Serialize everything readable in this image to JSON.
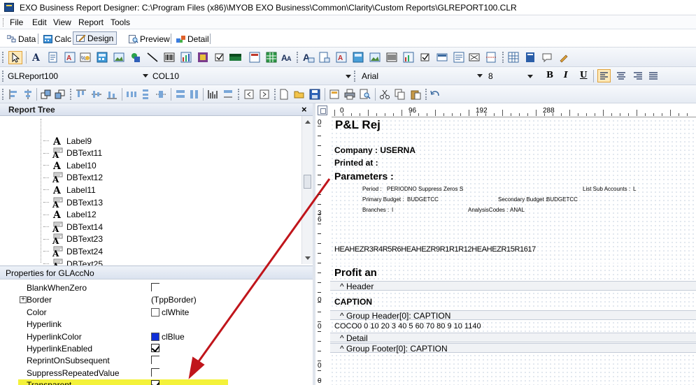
{
  "window": {
    "title": "EXO Business Report Designer: C:\\Program Files (x86)\\MYOB EXO Business\\Common\\Clarity\\Custom Reports\\GLREPORT100.CLR"
  },
  "menu": [
    "File",
    "Edit",
    "View",
    "Report",
    "Tools"
  ],
  "view_tabs": [
    {
      "label": "Data",
      "icon": "data-icon"
    },
    {
      "label": "Calc",
      "icon": "calc-icon"
    },
    {
      "label": "Design",
      "icon": "design-icon",
      "active": true
    },
    {
      "label": "Preview",
      "icon": "preview-icon"
    },
    {
      "label": "Detail",
      "icon": "detail-icon"
    }
  ],
  "combos": {
    "report": "GLReport100",
    "component": "COL10",
    "font": "Arial",
    "size": "8"
  },
  "format_buttons": {
    "bold": "B",
    "italic": "I",
    "underline": "U"
  },
  "report_tree": {
    "title": "Report Tree",
    "close": "×",
    "items": [
      "Label9",
      "DBText11",
      "Label10",
      "DBText12",
      "Label11",
      "DBText13",
      "Label12",
      "DBText14",
      "DBText23",
      "DBText24",
      "DBText25"
    ]
  },
  "properties": {
    "title": "Properties for GLAccNo",
    "rows": [
      {
        "name": "BlankWhenZero",
        "value": "",
        "check": "off"
      },
      {
        "name": "Border",
        "value": "(TppBorder)",
        "expander": "+"
      },
      {
        "name": "Color",
        "value": "clWhite",
        "swatch": "#ffffff"
      },
      {
        "name": "Hyperlink",
        "value": ""
      },
      {
        "name": "HyperlinkColor",
        "value": "clBlue",
        "swatch": "#1030d8"
      },
      {
        "name": "HyperlinkEnabled",
        "value": "",
        "check": "on"
      },
      {
        "name": "ReprintOnSubsequent",
        "value": "",
        "check": "off"
      },
      {
        "name": "SuppressRepeatedValue",
        "value": "",
        "check": "off"
      },
      {
        "name": "Transparent",
        "value": "",
        "check": "on",
        "highlight": true
      }
    ]
  },
  "ruler": {
    "h_numbers": [
      "0",
      "96",
      "192",
      "288"
    ],
    "v_marks": [
      "0",
      "3",
      "6",
      "0",
      "0",
      "0",
      "0"
    ]
  },
  "design": {
    "title": "P&L Rej",
    "company": "Company : USERNA",
    "printed": "Printed at :",
    "parameters": "Parameters :",
    "param_period": "Period :",
    "param_periodno": "PERIODNO",
    "param_suppress": "Suppress Zeros :",
    "param_suppress_val": "S",
    "param_listsub": "List Sub Accounts :",
    "param_listsub_val": "L",
    "param_primary": "Primary Budget :",
    "param_primary_val": "BUDGETCC",
    "param_secondary": "Secondary Budget :",
    "param_secondary_val": "BUDGETCC",
    "param_branches": "Branches :",
    "param_branches_val": "I",
    "param_analysis": "AnalysisCodes :",
    "param_analysis_val": "ANAL",
    "header_row": "HEAHEZR3R4R5R6HEAHEZR9R1R1R12HEAHEZR15R1617",
    "profit": "Profit an",
    "band_header": "^ Header",
    "caption": "CAPTION",
    "band_group_header": "^ Group Header[0]: CAPTION",
    "col_row": "COCO0 0 10 20 3 40 5 60 70 80 9 10 1140",
    "band_detail": "^ Detail",
    "band_group_footer": "^ Group Footer[0]: CAPTION"
  },
  "colors": {
    "highlight": "#f4f23a",
    "arrow": "#c0151b",
    "accent": "#1c4b8f"
  }
}
